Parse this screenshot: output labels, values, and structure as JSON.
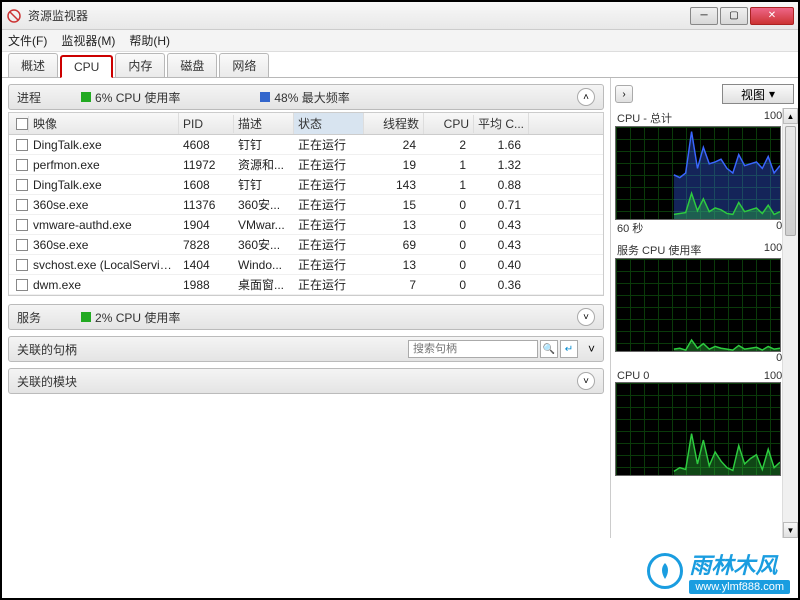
{
  "window": {
    "title": "资源监视器"
  },
  "menu": [
    "文件(F)",
    "监视器(M)",
    "帮助(H)"
  ],
  "tabs": [
    "概述",
    "CPU",
    "内存",
    "磁盘",
    "网络"
  ],
  "active_tab": 1,
  "process_section": {
    "title": "进程",
    "stat1": "6% CPU 使用率",
    "stat2": "48% 最大频率"
  },
  "columns": [
    "",
    "映像",
    "PID",
    "描述",
    "状态",
    "线程数",
    "CPU",
    "平均 C..."
  ],
  "rows": [
    {
      "name": "DingTalk.exe",
      "pid": "4608",
      "desc": "钉钉",
      "status": "正在运行",
      "threads": "24",
      "cpu": "2",
      "avg": "1.66"
    },
    {
      "name": "perfmon.exe",
      "pid": "11972",
      "desc": "资源和...",
      "status": "正在运行",
      "threads": "19",
      "cpu": "1",
      "avg": "1.32"
    },
    {
      "name": "DingTalk.exe",
      "pid": "1608",
      "desc": "钉钉",
      "status": "正在运行",
      "threads": "143",
      "cpu": "1",
      "avg": "0.88"
    },
    {
      "name": "360se.exe",
      "pid": "11376",
      "desc": "360安...",
      "status": "正在运行",
      "threads": "15",
      "cpu": "0",
      "avg": "0.71"
    },
    {
      "name": "vmware-authd.exe",
      "pid": "1904",
      "desc": "VMwar...",
      "status": "正在运行",
      "threads": "13",
      "cpu": "0",
      "avg": "0.43"
    },
    {
      "name": "360se.exe",
      "pid": "7828",
      "desc": "360安...",
      "status": "正在运行",
      "threads": "69",
      "cpu": "0",
      "avg": "0.43"
    },
    {
      "name": "svchost.exe (LocalServiceN...",
      "pid": "1404",
      "desc": "Windo...",
      "status": "正在运行",
      "threads": "13",
      "cpu": "0",
      "avg": "0.40"
    },
    {
      "name": "dwm.exe",
      "pid": "1988",
      "desc": "桌面窗...",
      "status": "正在运行",
      "threads": "7",
      "cpu": "0",
      "avg": "0.36"
    }
  ],
  "services_section": {
    "title": "服务",
    "stat1": "2% CPU 使用率"
  },
  "handles_section": {
    "title": "关联的句柄",
    "search_placeholder": "搜索句柄"
  },
  "modules_section": {
    "title": "关联的模块"
  },
  "side": {
    "view_label": "视图",
    "graphs": [
      {
        "title": "CPU - 总计",
        "right": "100%",
        "footer_left": "60 秒",
        "footer_right": "0%"
      },
      {
        "title": "服务 CPU 使用率",
        "right": "100%",
        "footer_left": "",
        "footer_right": "0%"
      },
      {
        "title": "CPU 0",
        "right": "100%",
        "footer_left": "",
        "footer_right": ""
      }
    ]
  },
  "watermark": {
    "text": "雨林木风",
    "url": "www.ylmf888.com"
  },
  "chart_data": [
    {
      "type": "line",
      "title": "CPU - 总计",
      "ylim": [
        0,
        100
      ],
      "xlabel": "60 秒",
      "series": [
        {
          "name": "blue",
          "color": "#3a66ff",
          "values": [
            48,
            45,
            50,
            95,
            55,
            78,
            60,
            62,
            65,
            55,
            50,
            70,
            58,
            60,
            62,
            55,
            68,
            50,
            58
          ]
        },
        {
          "name": "green",
          "color": "#2ecc40",
          "values": [
            5,
            6,
            7,
            28,
            9,
            22,
            8,
            12,
            10,
            6,
            5,
            18,
            8,
            10,
            12,
            6,
            15,
            5,
            8
          ]
        }
      ]
    },
    {
      "type": "line",
      "title": "服务 CPU 使用率",
      "ylim": [
        0,
        100
      ],
      "series": [
        {
          "name": "green",
          "color": "#2ecc40",
          "values": [
            2,
            3,
            1,
            12,
            3,
            8,
            2,
            5,
            3,
            2,
            1,
            6,
            2,
            3,
            4,
            1,
            5,
            2,
            3
          ]
        }
      ]
    },
    {
      "type": "line",
      "title": "CPU 0",
      "ylim": [
        0,
        100
      ],
      "series": [
        {
          "name": "green",
          "color": "#2ecc40",
          "values": [
            4,
            8,
            6,
            45,
            12,
            38,
            10,
            25,
            15,
            8,
            5,
            32,
            12,
            18,
            22,
            6,
            28,
            8,
            14
          ]
        }
      ]
    }
  ]
}
